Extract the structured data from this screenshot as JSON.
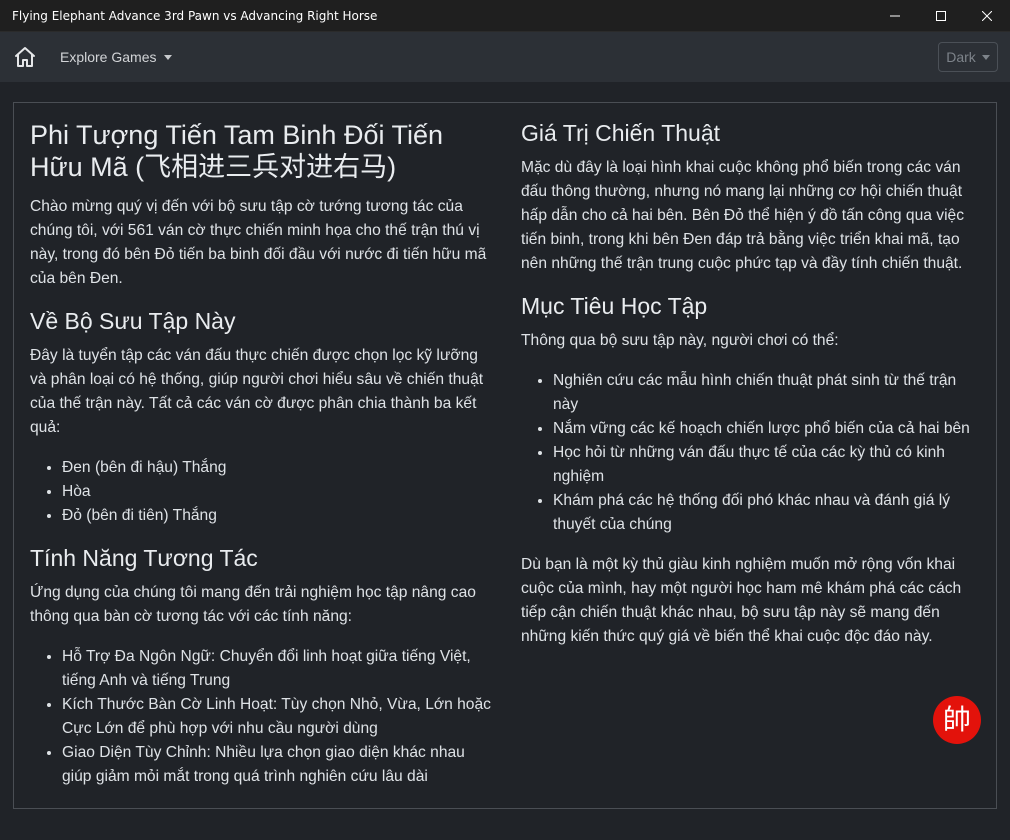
{
  "window": {
    "title": "Flying Elephant Advance 3rd Pawn vs Advancing Right Horse"
  },
  "navbar": {
    "explore_label": "Explore Games",
    "theme_label": "Dark"
  },
  "icons": {
    "home": "home-icon",
    "minimize": "minimize-icon",
    "maximize": "maximize-icon",
    "close": "close-icon",
    "badge": "general-piece-icon"
  },
  "colors": {
    "badge_red": "#e3120b",
    "background": "#202328",
    "navbar": "#2c3036"
  },
  "left": {
    "title": "Phi Tượng Tiến Tam Binh Đối Tiến Hữu Mã (飞相进三兵对进右马)",
    "intro": "Chào mừng quý vị đến với bộ sưu tập cờ tướng tương tác của chúng tôi, với 561 ván cờ thực chiến minh họa cho thế trận thú vị này, trong đó bên Đỏ tiến ba binh đối đầu với nước đi tiến hữu mã của bên Đen.",
    "about_heading": "Về Bộ Sưu Tập Này",
    "about_text": "Đây là tuyển tập các ván đấu thực chiến được chọn lọc kỹ lưỡng và phân loại có hệ thống, giúp người chơi hiểu sâu về chiến thuật của thế trận này. Tất cả các ván cờ được phân chia thành ba kết quả:",
    "results": [
      "Đen (bên đi hậu) Thắng",
      "Hòa",
      "Đỏ (bên đi tiên) Thắng"
    ],
    "features_heading": "Tính Năng Tương Tác",
    "features_text": "Ứng dụng của chúng tôi mang đến trải nghiệm học tập nâng cao thông qua bàn cờ tương tác với các tính năng:",
    "features": [
      "Hỗ Trợ Đa Ngôn Ngữ: Chuyển đổi linh hoạt giữa tiếng Việt, tiếng Anh và tiếng Trung",
      "Kích Thước Bàn Cờ Linh Hoạt: Tùy chọn Nhỏ, Vừa, Lớn hoặc Cực Lớn để phù hợp với nhu cầu người dùng",
      "Giao Diện Tùy Chỉnh: Nhiều lựa chọn giao diện khác nhau giúp giảm mỏi mắt trong quá trình nghiên cứu lâu dài"
    ]
  },
  "right": {
    "value_heading": "Giá Trị Chiến Thuật",
    "value_text": "Mặc dù đây là loại hình khai cuộc không phổ biến trong các ván đấu thông thường, nhưng nó mang lại những cơ hội chiến thuật hấp dẫn cho cả hai bên. Bên Đỏ thể hiện ý đồ tấn công qua việc tiến binh, trong khi bên Đen đáp trả bằng việc triển khai mã, tạo nên những thế trận trung cuộc phức tạp và đầy tính chiến thuật.",
    "goals_heading": "Mục Tiêu Học Tập",
    "goals_text": "Thông qua bộ sưu tập này, người chơi có thể:",
    "goals": [
      "Nghiên cứu các mẫu hình chiến thuật phát sinh từ thế trận này",
      "Nắm vững các kế hoạch chiến lược phổ biến của cả hai bên",
      "Học hỏi từ những ván đấu thực tế của các kỳ thủ có kinh nghiệm",
      "Khám phá các hệ thống đối phó khác nhau và đánh giá lý thuyết của chúng"
    ],
    "closing": "Dù bạn là một kỳ thủ giàu kinh nghiệm muốn mở rộng vốn khai cuộc của mình, hay một người học ham mê khám phá các cách tiếp cận chiến thuật khác nhau, bộ sưu tập này sẽ mang đến những kiến thức quý giá về biến thể khai cuộc độc đáo này."
  },
  "badge": {
    "glyph": "帥"
  }
}
